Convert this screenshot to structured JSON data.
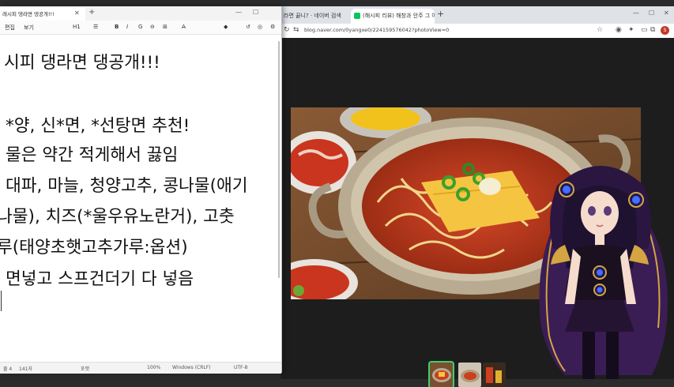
{
  "browser": {
    "tabs": [
      {
        "label": "라면 끓니?  ·  네이버 검색"
      },
      {
        "label": "(해시피 리뷰) 해창과 안주 그 어"
      }
    ],
    "new_tab": "+",
    "url": "blog.naver.com/0yangxe0/224159576042?photoView=0",
    "window_controls": {
      "minimize": "—",
      "maximize": "☐",
      "close": "✕"
    },
    "nav": {
      "back": "←",
      "forward": "→",
      "reload": "↻",
      "site_info": "⇆"
    },
    "profile": "S"
  },
  "notepad": {
    "tab_title": "레시피 댕라면 댕공개!!!",
    "tab_close": "✕",
    "new_tab": "+",
    "menu": {
      "edit": "편집",
      "view": "보기",
      "heading": "H1",
      "list": "☰",
      "bold": "B",
      "italic": "I",
      "link": "G",
      "strike": "⊖",
      "table": "⊞",
      "clear": "A̶"
    },
    "window_controls": {
      "minimize": "—",
      "maximize": "☐"
    },
    "lines": [
      "시피 댕라면 댕공개!!!",
      "",
      "*양, 신*면, *선탕면 추천!",
      "물은 약간 적게해서 끓임",
      "대파, 마늘, 청양고추, 콩나물(애기",
      "나물), 치즈(*울우유노란거), 고춧",
      "루(태양초햇고추가루:옵션)",
      "면넣고 스프건더기 다 넣음"
    ],
    "status": {
      "position": "줄 4",
      "chars": "141자",
      "format": "포맷",
      "zoom": "100%",
      "line_ending": "Windows (CRLF)",
      "encoding": "UTF-8"
    }
  }
}
